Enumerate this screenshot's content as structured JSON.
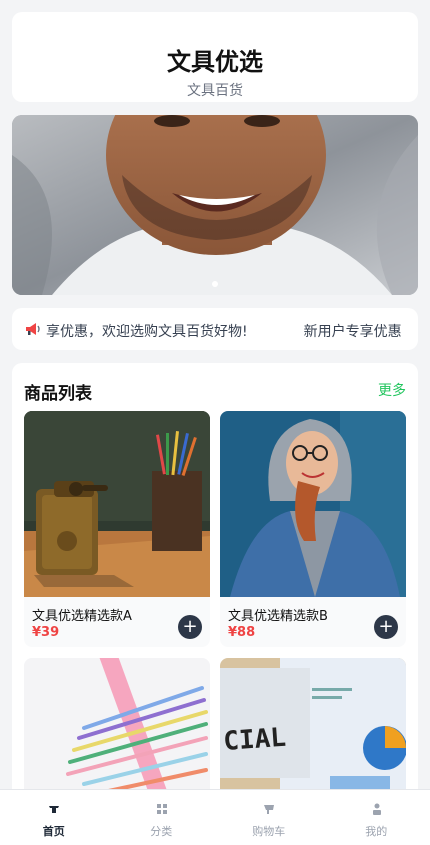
{
  "header": {
    "title": "文具优选",
    "subtitle": "文具百货"
  },
  "banner": {
    "image": "smiling-man-portrait",
    "active_dot": 1,
    "dot_count": 1
  },
  "notice": {
    "icon": "megaphone-icon",
    "text_visible": "享优惠，欢迎选购文具百货好物!",
    "text_repeat": "新用户专享优惠"
  },
  "products_section": {
    "title": "商品列表",
    "more_label": "更多",
    "items": [
      {
        "name": "文具优选精选款A",
        "price": "¥39",
        "image": "pencil-sharpener-photo"
      },
      {
        "name": "文具优选精选款B",
        "price": "¥88",
        "image": "woman-denim-jacket-photo"
      },
      {
        "name": "",
        "price": "",
        "image": "colored-pencils-photo"
      },
      {
        "name": "",
        "price": "",
        "image": "desk-letterboard-photo"
      }
    ],
    "add_label": "+"
  },
  "tabbar": {
    "items": [
      {
        "label": "首页",
        "icon": "home-icon",
        "active": true
      },
      {
        "label": "分类",
        "icon": "grid-icon",
        "active": false
      },
      {
        "label": "购物车",
        "icon": "cart-icon",
        "active": false
      },
      {
        "label": "我的",
        "icon": "user-icon",
        "active": false
      }
    ]
  },
  "colors": {
    "accent_more": "#22c55e",
    "price": "#ef4444",
    "add_button": "#2d3748",
    "background": "#f3f4f6"
  }
}
